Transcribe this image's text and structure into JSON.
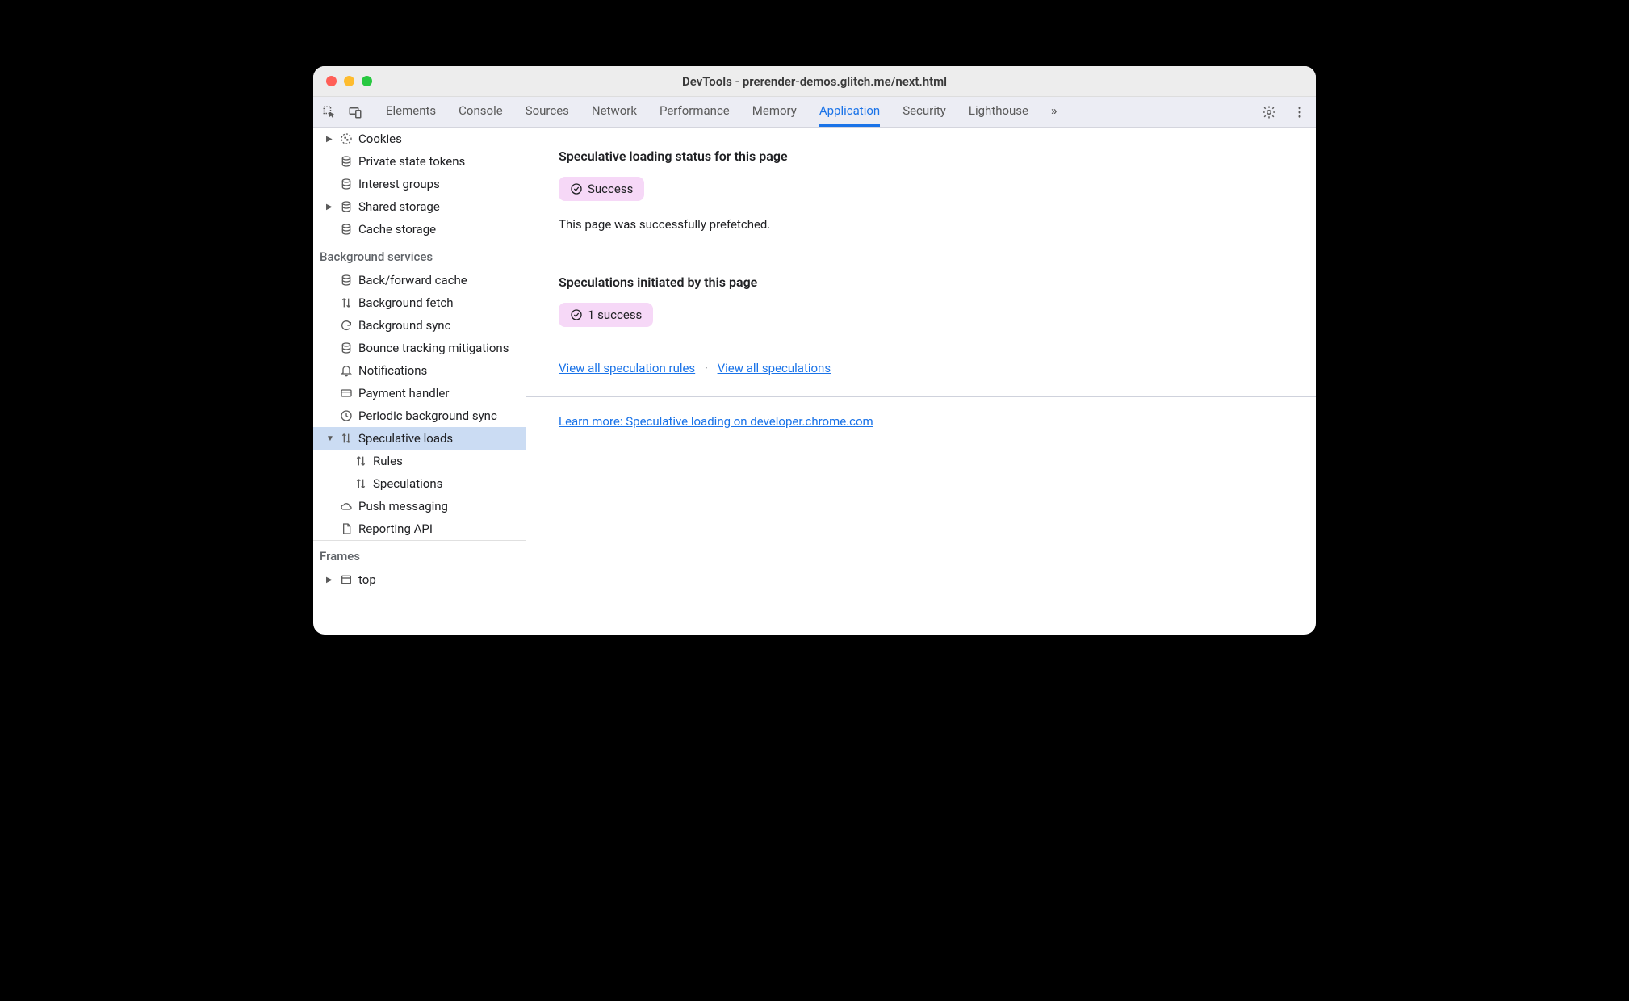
{
  "window": {
    "title": "DevTools - prerender-demos.glitch.me/next.html"
  },
  "toolbar": {
    "tabs": [
      {
        "label": "Elements"
      },
      {
        "label": "Console"
      },
      {
        "label": "Sources"
      },
      {
        "label": "Network"
      },
      {
        "label": "Performance"
      },
      {
        "label": "Memory"
      },
      {
        "label": "Application",
        "active": true
      },
      {
        "label": "Security"
      },
      {
        "label": "Lighthouse"
      }
    ],
    "overflow": "»"
  },
  "sidebar": {
    "storage_items": [
      {
        "label": "Cookies",
        "caret": "▶",
        "icon": "cookie"
      },
      {
        "label": "Private state tokens",
        "icon": "db"
      },
      {
        "label": "Interest groups",
        "icon": "db"
      },
      {
        "label": "Shared storage",
        "caret": "▶",
        "icon": "db"
      },
      {
        "label": "Cache storage",
        "icon": "db"
      }
    ],
    "bg_header": "Background services",
    "bg_items": [
      {
        "label": "Back/forward cache",
        "icon": "db"
      },
      {
        "label": "Background fetch",
        "icon": "arrows"
      },
      {
        "label": "Background sync",
        "icon": "sync"
      },
      {
        "label": "Bounce tracking mitigations",
        "icon": "db"
      },
      {
        "label": "Notifications",
        "icon": "bell"
      },
      {
        "label": "Payment handler",
        "icon": "card"
      },
      {
        "label": "Periodic background sync",
        "icon": "clock"
      },
      {
        "label": "Speculative loads",
        "caret": "▼",
        "icon": "arrows",
        "selected": true
      },
      {
        "label": "Rules",
        "icon": "arrows",
        "indent": true
      },
      {
        "label": "Speculations",
        "icon": "arrows",
        "indent": true
      },
      {
        "label": "Push messaging",
        "icon": "cloud"
      },
      {
        "label": "Reporting API",
        "icon": "doc"
      }
    ],
    "frames_header": "Frames",
    "frames_items": [
      {
        "label": "top",
        "caret": "▶",
        "icon": "frame"
      }
    ]
  },
  "main": {
    "status_heading": "Speculative loading status for this page",
    "status_badge": "Success",
    "status_desc": "This page was successfully prefetched.",
    "initiated_heading": "Speculations initiated by this page",
    "initiated_badge": "1 success",
    "link_rules": "View all speculation rules",
    "link_specs": "View all speculations",
    "learn_link": "Learn more: Speculative loading on developer.chrome.com"
  }
}
